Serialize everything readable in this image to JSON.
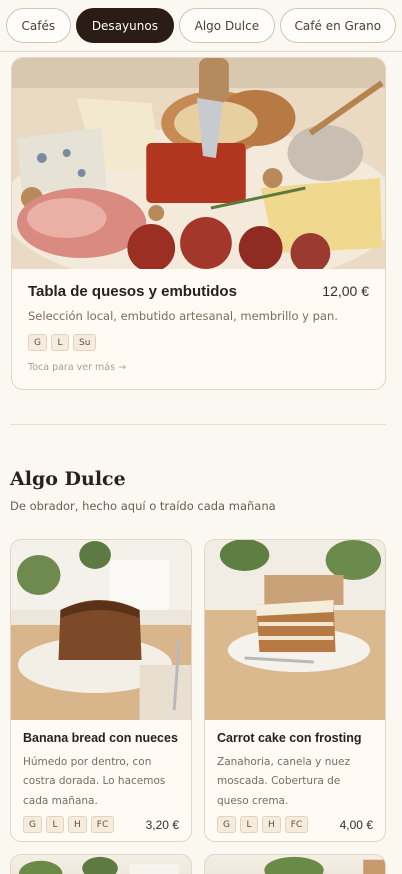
{
  "tabs": [
    {
      "label": "Cafés",
      "active": false
    },
    {
      "label": "Desayunos",
      "active": true
    },
    {
      "label": "Algo Dulce",
      "active": false
    },
    {
      "label": "Café en Grano",
      "active": false
    }
  ],
  "featured": {
    "title": "Tabla de quesos y embutidos",
    "price": "12,00 €",
    "description": "Selección local, embutido artesanal, membrillo y pan.",
    "tags": [
      "G",
      "L",
      "Su"
    ],
    "hint": "Toca para ver más →"
  },
  "section": {
    "title": "Algo Dulce",
    "subtitle": "De obrador, hecho aquí o traído cada mañana"
  },
  "products": [
    {
      "title": "Banana bread con nueces",
      "description": "Húmedo por dentro, con costra dorada. Lo hacemos cada mañana.",
      "tags": [
        "G",
        "L",
        "H",
        "FC"
      ],
      "price": "3,20 €"
    },
    {
      "title": "Carrot cake con frosting",
      "description": "Zanahoria, canela y nuez moscada. Cobertura de queso crema.",
      "tags": [
        "G",
        "L",
        "H",
        "FC"
      ],
      "price": "4,00 €"
    }
  ]
}
